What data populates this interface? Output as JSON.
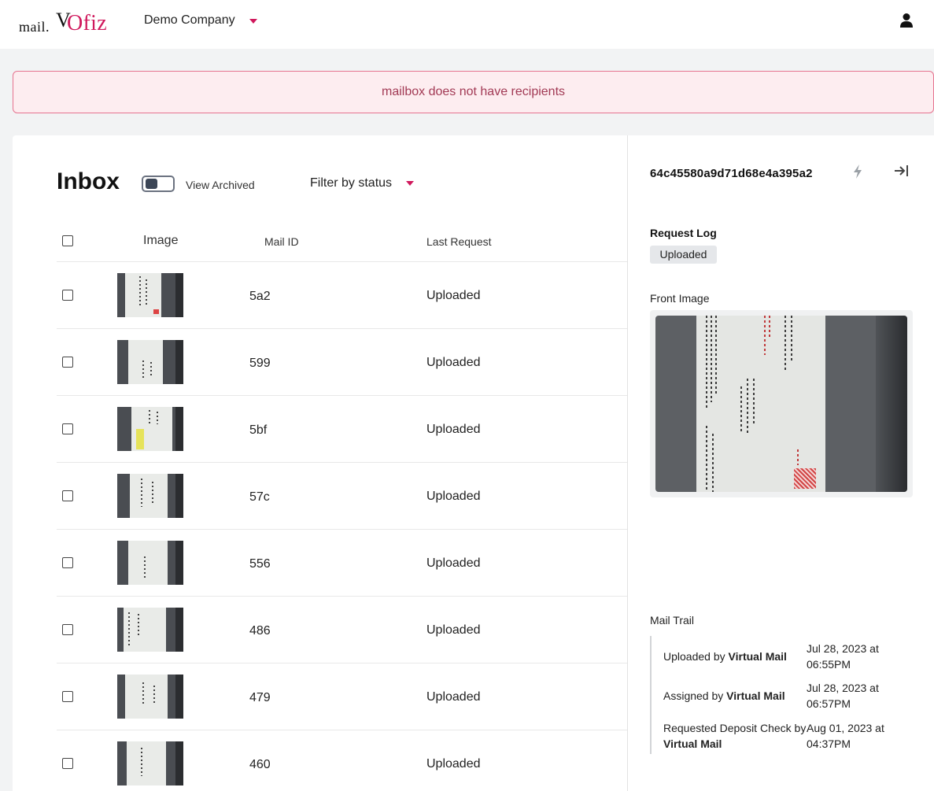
{
  "brand": {
    "prefix": "mail.",
    "v": "V",
    "name": "Ofiz",
    "accent": "#d0185c"
  },
  "header": {
    "company": "Demo Company"
  },
  "alert": {
    "message": "mailbox does not have recipients"
  },
  "inbox": {
    "title": "Inbox",
    "view_archived": "View Archived",
    "filter_label": "Filter by status",
    "columns": {
      "image": "Image",
      "mail_id": "Mail ID",
      "last_request": "Last Request"
    },
    "rows": [
      {
        "id": "5a2",
        "status": "Uploaded"
      },
      {
        "id": "599",
        "status": "Uploaded"
      },
      {
        "id": "5bf",
        "status": "Uploaded"
      },
      {
        "id": "57c",
        "status": "Uploaded"
      },
      {
        "id": "556",
        "status": "Uploaded"
      },
      {
        "id": "486",
        "status": "Uploaded"
      },
      {
        "id": "479",
        "status": "Uploaded"
      },
      {
        "id": "460",
        "status": "Uploaded"
      }
    ]
  },
  "detail": {
    "id": "64c45580a9d71d68e4a395a2",
    "request_log_label": "Request Log",
    "request_log_status": "Uploaded",
    "front_image_label": "Front Image",
    "mail_trail_label": "Mail Trail",
    "trail": [
      {
        "action": "Uploaded by ",
        "actor": "Virtual Mail",
        "date1": "Jul 28, 2023 at",
        "date2": "06:55PM"
      },
      {
        "action": "Assigned by ",
        "actor": "Virtual Mail",
        "date1": "Jul 28, 2023 at",
        "date2": "06:57PM"
      },
      {
        "action": "Requested Deposit Check by",
        "actor": "Virtual Mail",
        "date1": "Aug 01, 2023 at",
        "date2": "04:37PM"
      }
    ]
  }
}
